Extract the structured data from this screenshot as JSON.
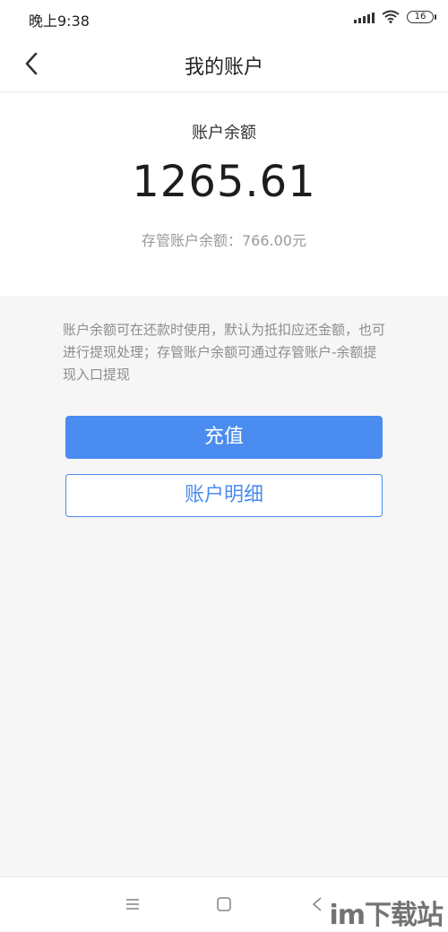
{
  "status_bar": {
    "time": "晚上9:38",
    "battery": "16"
  },
  "header": {
    "title": "我的账户",
    "back_icon": "chevron-left-icon"
  },
  "balance": {
    "label": "账户余额",
    "amount": "1265.61",
    "custody_label": "存管账户余额：766.00元"
  },
  "notice": {
    "text": "账户余额可在还款时使用，默认为抵扣应还金额，也可进行提现处理；存管账户余额可通过存管账户-余额提现入口提现"
  },
  "actions": {
    "recharge_label": "充值",
    "details_label": "账户明细"
  },
  "watermark": {
    "text": "im下载站"
  },
  "colors": {
    "accent": "#4a8cf0",
    "background": "#f6f6f6",
    "muted_text": "#999999"
  }
}
